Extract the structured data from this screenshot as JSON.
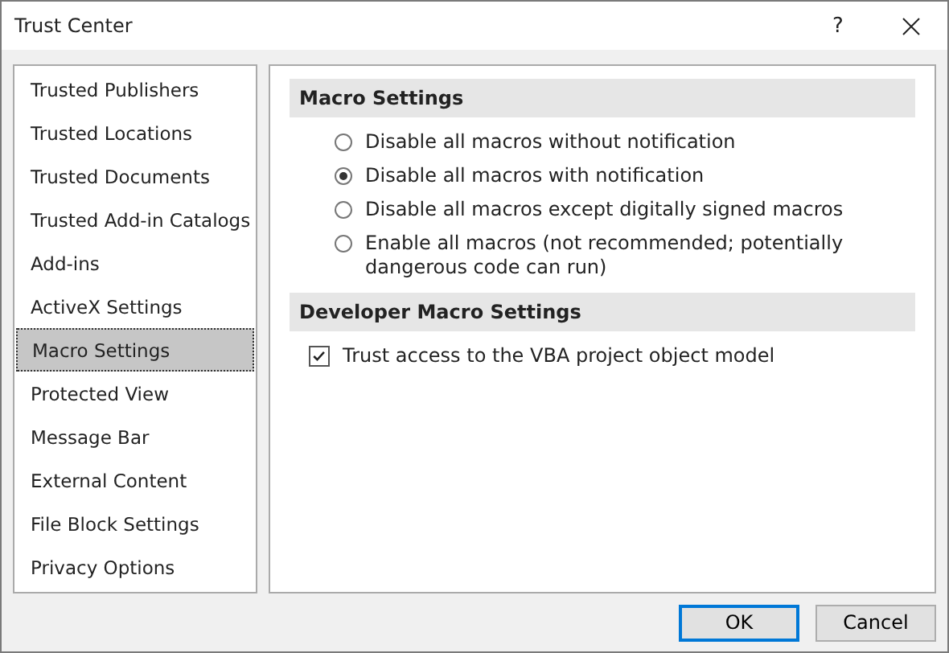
{
  "window": {
    "title": "Trust Center",
    "help": "?"
  },
  "sidebar": {
    "items": [
      {
        "label": "Trusted Publishers",
        "selected": false
      },
      {
        "label": "Trusted Locations",
        "selected": false
      },
      {
        "label": "Trusted Documents",
        "selected": false
      },
      {
        "label": "Trusted Add-in Catalogs",
        "selected": false
      },
      {
        "label": "Add-ins",
        "selected": false
      },
      {
        "label": "ActiveX Settings",
        "selected": false
      },
      {
        "label": "Macro Settings",
        "selected": true
      },
      {
        "label": "Protected View",
        "selected": false
      },
      {
        "label": "Message Bar",
        "selected": false
      },
      {
        "label": "External Content",
        "selected": false
      },
      {
        "label": "File Block Settings",
        "selected": false
      },
      {
        "label": "Privacy Options",
        "selected": false
      }
    ]
  },
  "sections": [
    {
      "title": "Macro Settings",
      "options": [
        {
          "kind": "radio",
          "label": "Disable all macros without notification",
          "selected": false
        },
        {
          "kind": "radio",
          "label": "Disable all macros with notification",
          "selected": true
        },
        {
          "kind": "radio",
          "label": "Disable all macros except digitally signed macros",
          "selected": false
        },
        {
          "kind": "radio",
          "label": "Enable all macros (not recommended; potentially dangerous code can run)",
          "selected": false
        }
      ]
    },
    {
      "title": "Developer Macro Settings",
      "options": [
        {
          "kind": "checkbox",
          "label": "Trust access to the VBA project object model",
          "checked": true
        }
      ]
    }
  ],
  "buttons": [
    {
      "label": "OK",
      "default": true
    },
    {
      "label": "Cancel",
      "default": false
    }
  ]
}
